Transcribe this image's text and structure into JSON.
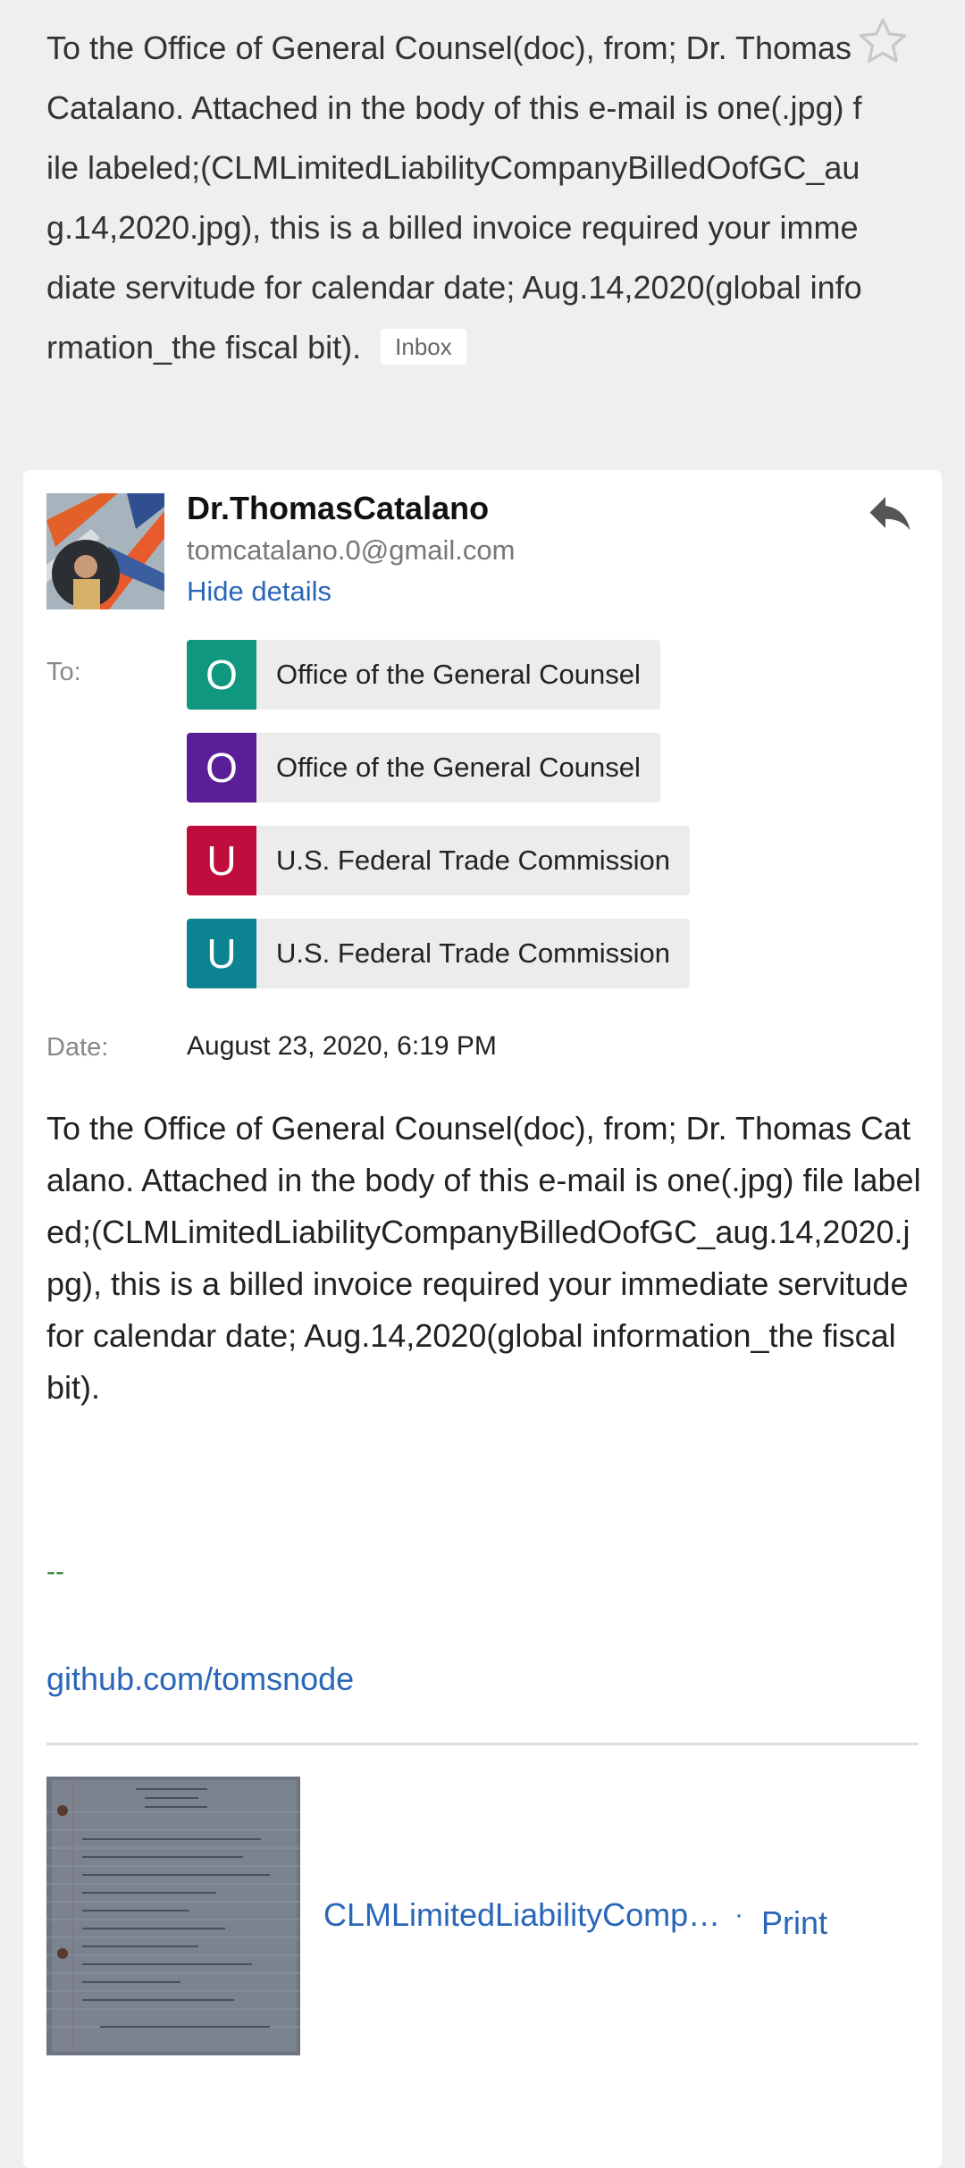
{
  "subject": {
    "text": "To the Office of General Counsel(doc), from; Dr. Thomas Catalano. Attached in the body of this e-mail is one(.jpg) file labeled;(CLMLimitedLiabilityCompanyBilledOofGC_aug.14,2020.jpg), this is a billed invoice required your immediate servitude for calendar date; Aug.14,2020(global information_the fiscal bit).",
    "badge": "Inbox",
    "star_icon": "star-outline-icon"
  },
  "sender": {
    "name": "Dr.ThomasCatalano",
    "email": "tomcatalano.0@gmail.com",
    "hide_details": "Hide details",
    "reply_icon": "reply-icon"
  },
  "recipients": {
    "label": "To:",
    "items": [
      {
        "initial": "O",
        "name": "Office of the General Counsel",
        "color": "#0f9780"
      },
      {
        "initial": "O",
        "name": "Office of the General Counsel",
        "color": "#5c1d99"
      },
      {
        "initial": "U",
        "name": "U.S. Federal Trade Commission",
        "color": "#bf0d3e"
      },
      {
        "initial": "U",
        "name": "U.S. Federal Trade Commission",
        "color": "#0b8391"
      }
    ]
  },
  "date": {
    "label": "Date:",
    "value": "August 23, 2020, 6:19 PM"
  },
  "body": {
    "text": "To the Office of General Counsel(doc), from; Dr. Thomas Catalano. Attached in the body of this e-mail is one(.jpg) file labeled;(CLMLimitedLiabilityCompanyBilledOofGC_aug.14,2020.jpg), this is a billed invoice required your immediate servitude for calendar date; Aug.14,2020(global information_the fiscal bit).",
    "signature_dash": "--",
    "signature_link": "github.com/tomsnode"
  },
  "attachment": {
    "name": "CLMLimitedLiabilityCompanyBilledOofGC_aug.14,2020.jpg",
    "separator": "·",
    "print": "Print"
  },
  "colors": {
    "link": "#2a66b8",
    "background": "#efefef"
  }
}
